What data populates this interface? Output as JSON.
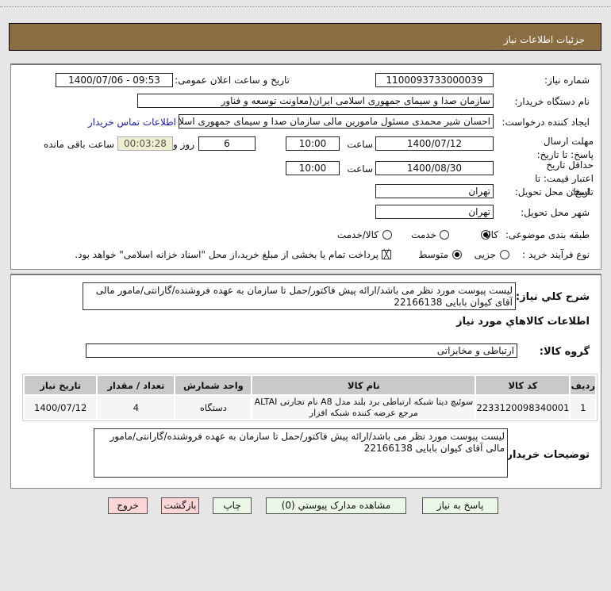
{
  "header": {
    "title": "جزئیات اطلاعات نیاز"
  },
  "form": {
    "need_number_label": "شماره نیاز:",
    "need_number": "1100093733000039",
    "announce_label": "تاریخ و ساعت اعلان عمومی:",
    "announce_value": "1400/07/06 - 09:53",
    "buyer_org_label": "نام دستگاه خریدار:",
    "buyer_org": "سازمان صدا و سیمای جمهوری اسلامی ایران(معاونت توسعه و فناور",
    "creator_label": "ایجاد کننده درخواست:",
    "creator": "احسان شیر محمدی مسئول مامورین مالی  سازمان صدا و سیمای جمهوری اسلا",
    "contact_link": "اطلاعات تماس خریدار",
    "deadline_label": "مهلت ارسال پاسخ: تا تاریخ:",
    "deadline_date": "1400/07/12",
    "time_label": "ساعت",
    "deadline_time": "10:00",
    "days": "6",
    "days_label": "روز و",
    "remaining": "00:03:28",
    "remaining_label": "ساعت باقی مانده",
    "validity_label": "حداقل تاریخ اعتبار قیمت: تا تاریخ:",
    "validity_date": "1400/08/30",
    "validity_time": "10:00",
    "province_label": "استان محل تحویل:",
    "province": "تهران",
    "city_label": "شهر محل تحویل:",
    "city": "تهران",
    "category_label": "طبقه بندی موضوعی:",
    "category_options": [
      "کالا",
      "خدمت",
      "کالا/خدمت"
    ],
    "category_selected": "کالا",
    "process_label": "نوع فرآیند خرید :",
    "process_options": [
      "جزیی",
      "متوسط"
    ],
    "process_selected": "متوسط",
    "treasury_text": "پرداخت تمام یا بخشی از مبلغ خرید،از محل \"اسناد خزانه اسلامی\" خواهد بود."
  },
  "details": {
    "desc_label": "شرح کلي نياز:",
    "desc": "لیست پیوست مورد نظر می باشد/ارائه پیش فاکتور/حمل تا سازمان به عهده فروشنده/گارانتی/مامور مالی آقای کیوان بابایی 22166138",
    "goods_title": "اطلاعات کالاهاي مورد نياز",
    "group_label": "گروه کالا:",
    "group": "ارتباطی و مخابراتی",
    "table": {
      "headers": [
        "ردیف",
        "کد کالا",
        "نام کالا",
        "واحد شمارش",
        "تعداد / مقدار",
        "تاریخ نیاز"
      ],
      "rows": [
        [
          "1",
          "2233120098340001",
          "سوئیچ دیتا شبکه ارتباطی برد بلند مدل A8 نام تجارتی ALTAI مرجع عرضه کننده شبکه افزار",
          "دستگاه",
          "4",
          "1400/07/12"
        ]
      ]
    },
    "notes_label": "توضیحات خریدار:",
    "notes": "لیست پیوست مورد نظر می باشد/ارائه پیش فاکتور/حمل تا سازمان به عهده فروشنده/گارانتی/مامور مالی آقای کیوان بابایی 22166138"
  },
  "buttons": {
    "reply": "پاسخ به نیاز",
    "attachments": "مشاهده مدارک پیوستي (0)",
    "print": "چاپ",
    "back": "بازگشت",
    "exit": "خروج"
  }
}
